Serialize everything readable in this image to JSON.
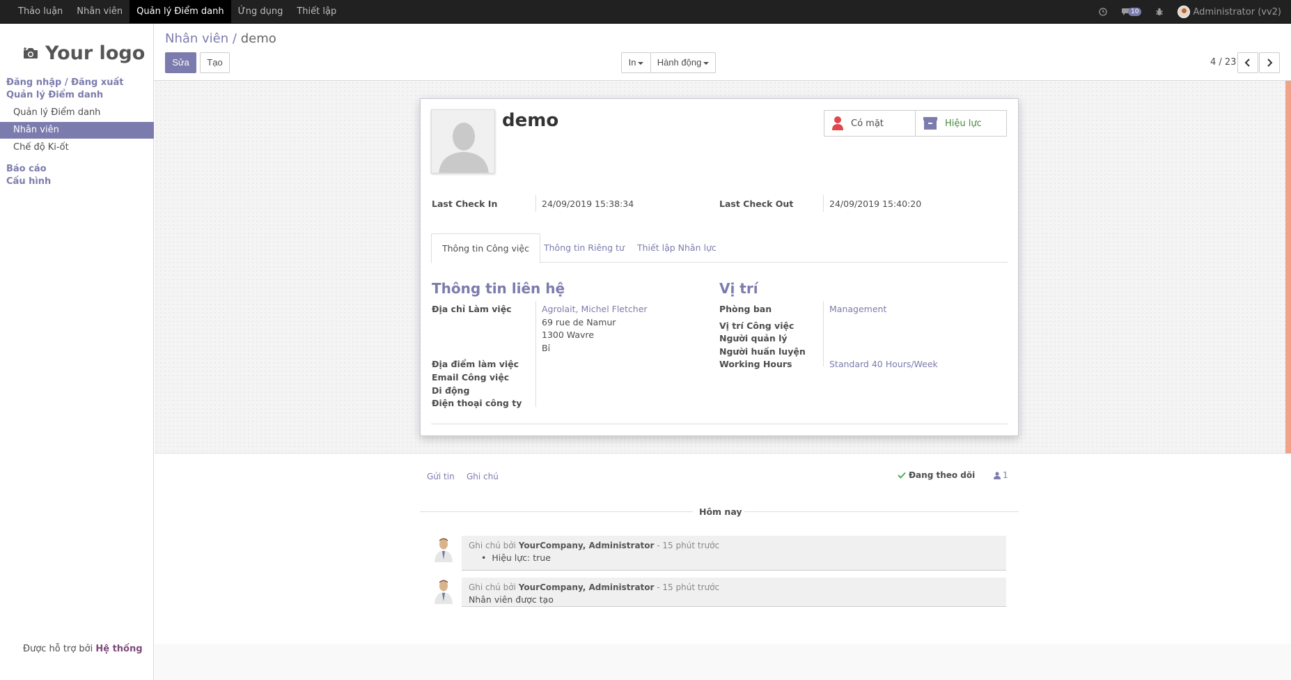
{
  "topbar": {
    "menu": [
      {
        "label": "Thảo luận",
        "active": false
      },
      {
        "label": "Nhân viên",
        "active": false
      },
      {
        "label": "Quản lý Điểm danh",
        "active": true
      },
      {
        "label": "Ứng dụng",
        "active": false
      },
      {
        "label": "Thiết lập",
        "active": false
      }
    ],
    "message_count": "10",
    "user": "Administrator (vv2)"
  },
  "sidebar": {
    "logo_text": "Your logo",
    "login_link": "Đăng nhập / Đăng xuất",
    "section_attendance": "Quản lý Điểm danh",
    "items": [
      {
        "label": "Quản lý Điểm danh",
        "active": false
      },
      {
        "label": "Nhân viên",
        "active": true
      },
      {
        "label": "Chế độ Ki-ốt",
        "active": false
      }
    ],
    "reports": "Báo cáo",
    "config": "Cấu hình",
    "powered_prefix": "Được hỗ trợ bởi",
    "powered_brand": "Hệ thống"
  },
  "control": {
    "breadcrumb_parent": "Nhân viên",
    "breadcrumb_sep": "/",
    "breadcrumb_current": "demo",
    "edit_label": "Sửa",
    "create_label": "Tạo",
    "print_label": "In",
    "action_label": "Hành động",
    "pager": "4 / 23"
  },
  "form": {
    "name": "demo",
    "presence_label": "Có mặt",
    "active_label": "Hiệu lực",
    "last_check_in_label": "Last Check In",
    "last_check_in": "24/09/2019 15:38:34",
    "last_check_out_label": "Last Check Out",
    "last_check_out": "24/09/2019 15:40:20",
    "tabs": [
      "Thông tin Công việc",
      "Thông tin Riêng tư",
      "Thiết lập Nhân lực"
    ],
    "contact_title": "Thông tin liên hệ",
    "work_address_label": "Địa chỉ Làm việc",
    "work_address_partner": "Agrolait, Michel Fletcher",
    "work_address_line1": "69 rue de Namur",
    "work_address_line2": "1300 Wavre",
    "work_address_line3": "Bỉ",
    "work_location_label": "Địa điểm làm việc",
    "work_email_label": "Email Công việc",
    "mobile_label": "Di động",
    "work_phone_label": "Điện thoại công ty",
    "position_title": "Vị trí",
    "department_label": "Phòng ban",
    "department": "Management",
    "job_label": "Vị trí Công việc",
    "manager_label": "Người quản lý",
    "coach_label": "Người huấn luyện",
    "hours_label": "Working Hours",
    "hours": "Standard 40 Hours/Week"
  },
  "chatter": {
    "send_message": "Gửi tin",
    "log_note": "Ghi chú",
    "following": "Đang theo dõi",
    "followers_count": "1",
    "today": "Hôm nay",
    "messages": [
      {
        "prefix": "Ghi chú bởi",
        "author": "YourCompany, Administrator",
        "time": "- 15 phút trước",
        "body": "Hiệu lực: true"
      },
      {
        "prefix": "Ghi chú bởi",
        "author": "YourCompany, Administrator",
        "time": "- 15 phút trước",
        "body": "Nhân viên được tạo"
      }
    ]
  },
  "colors": {
    "accent": "#7c7bad",
    "topbar": "#212121",
    "present_icon": "#e0474c",
    "active_text": "#4a8a3b"
  }
}
